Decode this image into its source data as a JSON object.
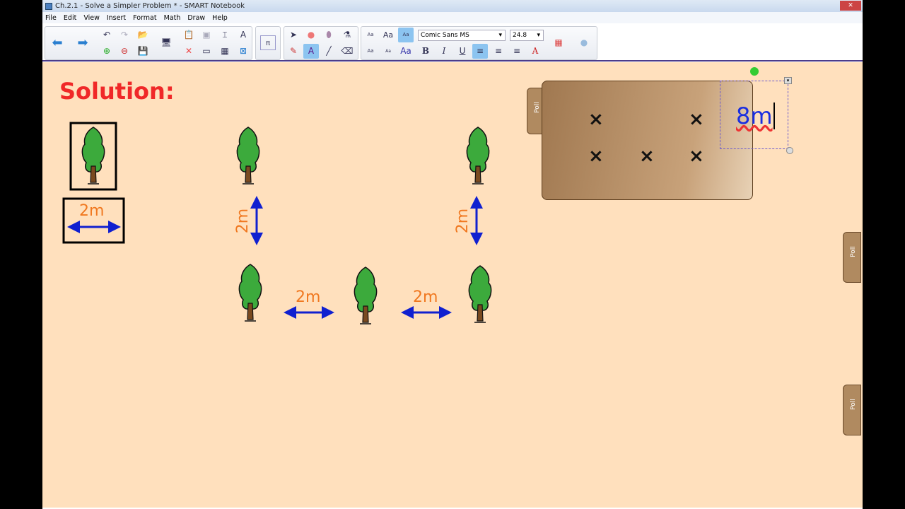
{
  "window": {
    "title": "Ch.2.1 - Solve a Simpler Problem * - SMART Notebook"
  },
  "menu": [
    "File",
    "Edit",
    "View",
    "Insert",
    "Format",
    "Math",
    "Draw",
    "Help"
  ],
  "toolbar": {
    "font_name": "Comic Sans MS",
    "font_size": "24.8",
    "bold": "B",
    "italic": "I",
    "underline": "U",
    "aa": "Aa"
  },
  "canvas": {
    "heading": "Solution:",
    "legend_label": "2m",
    "labels": [
      "2m",
      "2m",
      "2m",
      "2m"
    ],
    "panel": {
      "tab_label": "Poll",
      "mark": "×",
      "text": "8m"
    },
    "side_tabs": [
      "Poll",
      "Poll"
    ]
  },
  "colors": {
    "canvas": "#ffe0bd",
    "heading": "#f02828",
    "label": "#f07820",
    "arrow": "#1020d0",
    "panel": "#a07850"
  }
}
